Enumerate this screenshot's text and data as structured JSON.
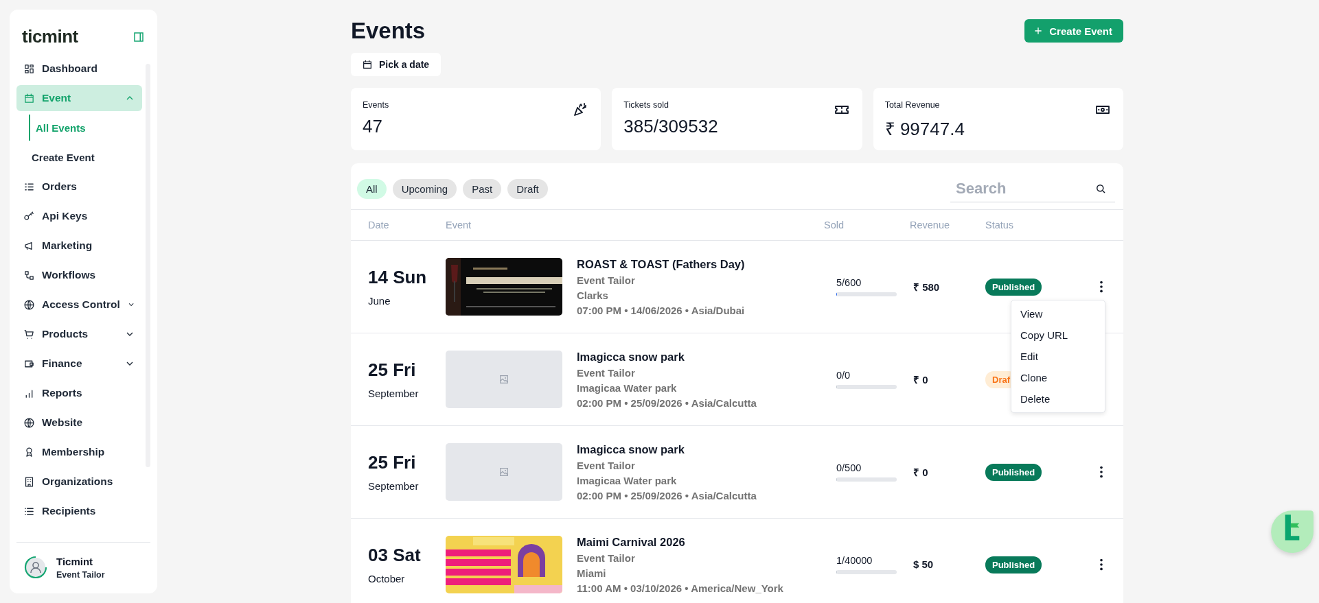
{
  "sidebar": {
    "brand": "ticmint",
    "items": [
      {
        "label": "Dashboard",
        "selected": false
      },
      {
        "label": "Event",
        "selected": true,
        "expanded": true,
        "children": [
          {
            "label": "All Events",
            "selected": true
          },
          {
            "label": "Create Event",
            "selected": false
          }
        ]
      },
      {
        "label": "Orders",
        "selected": false
      },
      {
        "label": "Api Keys",
        "selected": false
      },
      {
        "label": "Marketing",
        "selected": false
      },
      {
        "label": "Workflows",
        "selected": false
      },
      {
        "label": "Access Control",
        "selected": false,
        "expanded": false
      },
      {
        "label": "Products",
        "selected": false,
        "expanded": false
      },
      {
        "label": "Finance",
        "selected": false,
        "expanded": false
      },
      {
        "label": "Reports",
        "selected": false
      },
      {
        "label": "Website",
        "selected": false
      },
      {
        "label": "Membership",
        "selected": false
      },
      {
        "label": "Organizations",
        "selected": false
      },
      {
        "label": "Recipients",
        "selected": false
      }
    ],
    "user": {
      "name": "Ticmint",
      "role": "Event Tailor"
    }
  },
  "header": {
    "title": "Events",
    "create_button": "Create Event",
    "date_button": "Pick a date"
  },
  "stats": [
    {
      "label": "Events",
      "value": "47"
    },
    {
      "label": "Tickets sold",
      "value": "385/309532"
    },
    {
      "label": "Total Revenue",
      "value": "₹ 99747.4"
    }
  ],
  "filters": [
    {
      "label": "All",
      "selected": true
    },
    {
      "label": "Upcoming",
      "selected": false
    },
    {
      "label": "Past",
      "selected": false
    },
    {
      "label": "Draft",
      "selected": false
    }
  ],
  "search": {
    "placeholder": "Search"
  },
  "table": {
    "columns": [
      "Date",
      "Event",
      "Sold",
      "Revenue",
      "Status"
    ],
    "rows": [
      {
        "day": "14 Sun",
        "month": "June",
        "image": {
          "kind": "poster-dark"
        },
        "title": "ROAST & TOAST (Fathers Day)",
        "organizer": "Event Tailor",
        "venue": "Clarks",
        "schedule": "07:00 PM • 14/06/2026 • Asia/Dubai",
        "sold": "5/600",
        "level": 0.01,
        "revenue": "₹ 580",
        "status": {
          "label": "Published",
          "kind": "published"
        },
        "menu": [
          "View",
          "Copy URL",
          "Edit",
          "Clone",
          "Delete"
        ]
      },
      {
        "day": "25 Fri",
        "month": "September",
        "image": {
          "kind": "placeholder"
        },
        "title": "Imagicca snow park",
        "organizer": "Event Tailor",
        "venue": "Imagicaa Water park",
        "schedule": "02:00 PM • 25/09/2026 • Asia/Calcutta",
        "sold": "0/0",
        "level": 0,
        "revenue": "₹ 0",
        "status": {
          "label": "Draf",
          "kind": "draft"
        }
      },
      {
        "day": "25 Fri",
        "month": "September",
        "image": {
          "kind": "placeholder"
        },
        "title": "Imagicca snow park",
        "organizer": "Event Tailor",
        "venue": "Imagicaa Water park",
        "schedule": "02:00 PM • 25/09/2026 • Asia/Calcutta",
        "sold": "0/500",
        "level": 0,
        "revenue": "₹ 0",
        "status": {
          "label": "Published",
          "kind": "published"
        },
        "kebab": true
      },
      {
        "day": "03 Sat",
        "month": "October",
        "image": {
          "kind": "poster-bright"
        },
        "title": "Maimi Carnival 2026",
        "organizer": "Event Tailor",
        "venue": "Miami",
        "schedule": "11:00 AM • 03/10/2026 • America/New_York",
        "sold": "1/40000",
        "level": 0,
        "revenue": "$ 50",
        "status": {
          "label": "Published",
          "kind": "published"
        },
        "kebab": true
      }
    ]
  }
}
